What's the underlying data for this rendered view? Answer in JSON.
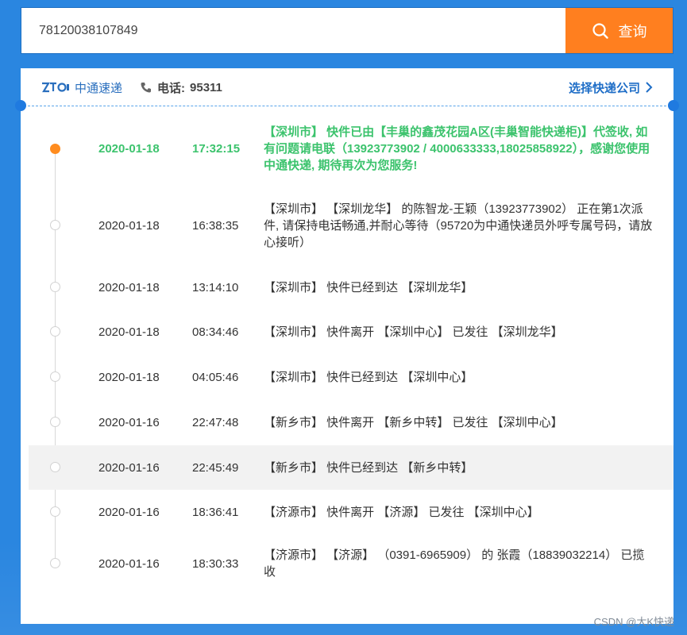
{
  "search": {
    "value": "78120038107849",
    "button_label": "查询"
  },
  "header": {
    "carrier_name": "中通速递",
    "phone_label": "电话:",
    "phone_number": "95311",
    "choose_carrier": "选择快递公司"
  },
  "events": [
    {
      "date": "2020-01-18",
      "time": "17:32:15",
      "desc": "【深圳市】 快件已由【丰巢的鑫茂花园A区(丰巢智能快递柜)】代签收, 如有问题请电联（13923773902 / 4000633333,18025858922），感谢您使用中通快递, 期待再次为您服务!"
    },
    {
      "date": "2020-01-18",
      "time": "16:38:35",
      "desc": "【深圳市】 【深圳龙华】 的陈智龙-王颖（13923773902） 正在第1次派件, 请保持电话畅通,并耐心等待（95720为中通快递员外呼专属号码，请放心接听）"
    },
    {
      "date": "2020-01-18",
      "time": "13:14:10",
      "desc": "【深圳市】 快件已经到达 【深圳龙华】"
    },
    {
      "date": "2020-01-18",
      "time": "08:34:46",
      "desc": "【深圳市】 快件离开 【深圳中心】 已发往 【深圳龙华】"
    },
    {
      "date": "2020-01-18",
      "time": "04:05:46",
      "desc": "【深圳市】 快件已经到达 【深圳中心】"
    },
    {
      "date": "2020-01-16",
      "time": "22:47:48",
      "desc": "【新乡市】 快件离开 【新乡中转】 已发往 【深圳中心】"
    },
    {
      "date": "2020-01-16",
      "time": "22:45:49",
      "desc": "【新乡市】 快件已经到达 【新乡中转】"
    },
    {
      "date": "2020-01-16",
      "time": "18:36:41",
      "desc": "【济源市】 快件离开 【济源】 已发往 【深圳中心】"
    },
    {
      "date": "2020-01-16",
      "time": "18:30:33",
      "desc": "【济源市】 【济源】 （0391-6965909） 的 张霞（18839032214） 已揽收"
    }
  ],
  "watermark": "CSDN @大K快递",
  "colors": {
    "background": "#2a86e0",
    "accent_button": "#ff7f1f",
    "latest_event": "#3cc36d",
    "link": "#1f6ec7"
  }
}
